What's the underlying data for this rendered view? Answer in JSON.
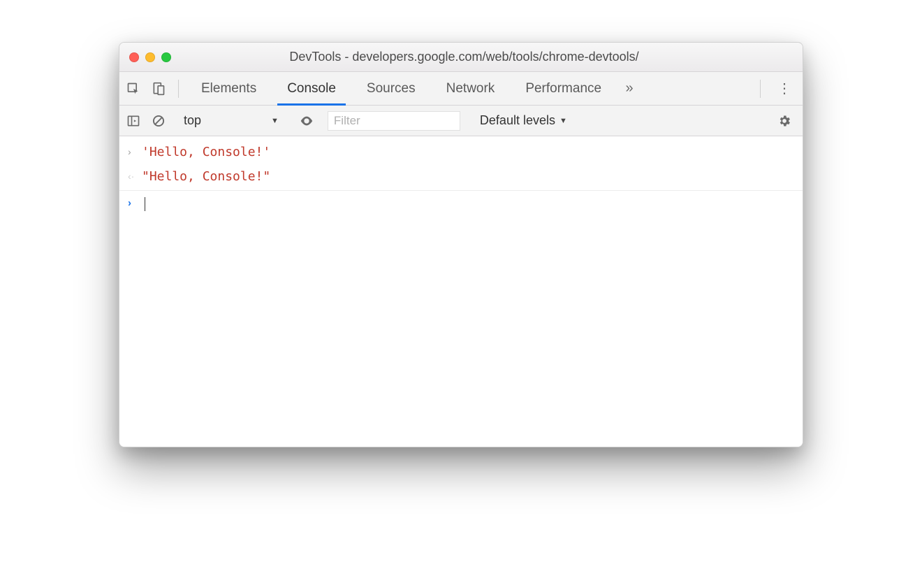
{
  "window": {
    "title": "DevTools - developers.google.com/web/tools/chrome-devtools/"
  },
  "tabs": {
    "items": [
      "Elements",
      "Console",
      "Sources",
      "Network",
      "Performance"
    ],
    "active_index": 1
  },
  "toolbar": {
    "context": "top",
    "filter_placeholder": "Filter",
    "filter_value": "",
    "levels_label": "Default levels"
  },
  "console": {
    "rows": [
      {
        "kind": "input",
        "text": "'Hello, Console!'"
      },
      {
        "kind": "output",
        "text": "\"Hello, Console!\""
      }
    ]
  }
}
